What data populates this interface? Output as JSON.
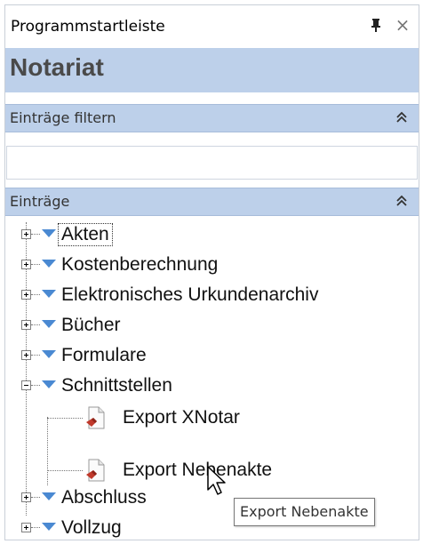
{
  "window": {
    "title": "Programmstartleiste",
    "pin_icon": "pin-icon",
    "close_icon": "close-icon",
    "close_glyph": "×"
  },
  "header": {
    "title": "Notariat"
  },
  "filter_section": {
    "label": "Einträge filtern",
    "collapse_icon": "chevron-double-up-icon",
    "input_value": ""
  },
  "entries_section": {
    "label": "Einträge",
    "collapse_icon": "chevron-double-up-icon"
  },
  "tree": {
    "items": [
      {
        "label": "Akten",
        "expanded": false,
        "focused": true
      },
      {
        "label": "Kostenberechnung",
        "expanded": false
      },
      {
        "label": "Elektronisches Urkundenarchiv",
        "expanded": false
      },
      {
        "label": "Bücher",
        "expanded": false
      },
      {
        "label": "Formulare",
        "expanded": false
      },
      {
        "label": "Schnittstellen",
        "expanded": true,
        "children": [
          {
            "label": "Export XNotar"
          },
          {
            "label": "Export Nebenakte"
          }
        ]
      },
      {
        "label": "Abschluss",
        "expanded": false
      },
      {
        "label": "Vollzug",
        "expanded": false
      }
    ]
  },
  "tooltip": {
    "text": "Export Nebenakte"
  },
  "colors": {
    "accent_band": "#bdd0ea",
    "triangle": "#4a89d2",
    "doc_mark": "#c0392b"
  }
}
